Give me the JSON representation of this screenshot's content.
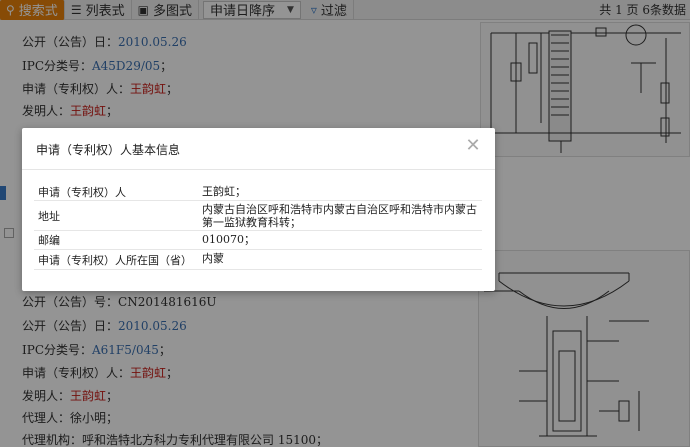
{
  "toolbar": {
    "search_view": "搜索式",
    "list_view": "列表式",
    "image_view": "多图式",
    "sort_select": "申请日降序",
    "filter": "过滤",
    "pagination_text": "共 1 页 6条数据"
  },
  "listing1": {
    "pub_date_label": "公开（公告）日：",
    "pub_date": "2010.05.26",
    "ipc_label": "IPC分类号：",
    "ipc": "A45D29/05",
    "ipc_suffix": "；",
    "applicant_label": "申请（专利权）人：",
    "applicant": "王韵虹",
    "applicant_suffix": "；",
    "inventor_label": "发明人：",
    "inventor": "王韵虹",
    "inventor_suffix": "；"
  },
  "listing2": {
    "pub_no_label": "公开（公告）号：",
    "pub_no": "CN201481616U",
    "pub_date_label": "公开（公告）日：",
    "pub_date": "2010.05.26",
    "ipc_label": "IPC分类号：",
    "ipc": "A61F5/045",
    "ipc_suffix": "；",
    "applicant_label": "申请（专利权）人：",
    "applicant": "王韵虹",
    "applicant_suffix": "；",
    "inventor_label": "发明人：",
    "inventor": "王韵虹",
    "inventor_suffix": "；",
    "agent_label": "代理人：",
    "agent": "徐小明；",
    "agency_label": "代理机构：",
    "agency": "呼和浩特北方科力专利代理有限公司 15100；"
  },
  "modal": {
    "title": "申请（专利权）人基本信息",
    "close_icon": "close-icon",
    "rows": [
      {
        "key": "申请（专利权）人",
        "value": "王韵虹；"
      },
      {
        "key": "地址",
        "value": "内蒙古自治区呼和浩特市内蒙古自治区呼和浩特市内蒙古第一监狱教育科转；"
      },
      {
        "key": "邮编",
        "value": "010070；"
      },
      {
        "key": "申请（专利权）人所在国（省）",
        "value": "内蒙"
      }
    ]
  },
  "colors": {
    "active_tab": "#e8820c",
    "link": "#3a6fb0",
    "name_red": "#c8201a",
    "overlay": "rgba(0,0,0,0.42)"
  }
}
